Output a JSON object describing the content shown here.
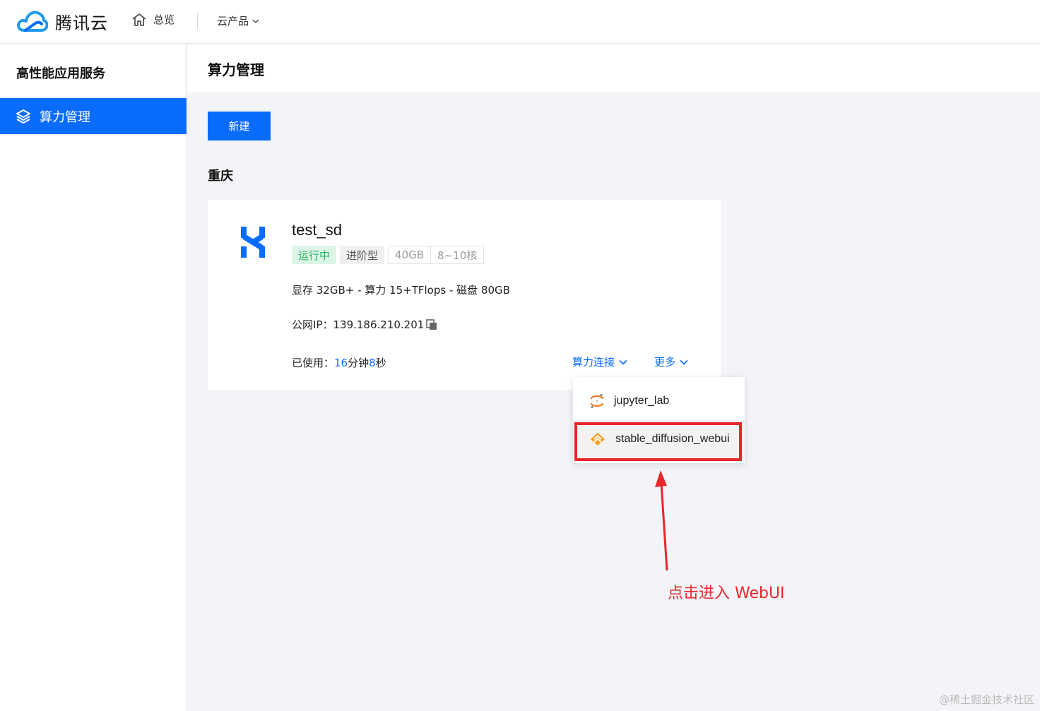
{
  "brand": {
    "name": "腾讯云"
  },
  "nav": {
    "home_label": "总览",
    "products_label": "云产品"
  },
  "sidebar": {
    "title": "高性能应用服务",
    "items": [
      {
        "label": "算力管理",
        "active": true
      }
    ]
  },
  "page": {
    "title": "算力管理"
  },
  "toolbar": {
    "new_label": "新建"
  },
  "region": {
    "title": "重庆"
  },
  "instance": {
    "name": "test_sd",
    "status": "运行中",
    "plan": "进阶型",
    "spec_gpu_mem": "40GB",
    "spec_cores": "8~10核",
    "specs": "显存 32GB+ - 算力 15+TFlops - 磁盘 80GB",
    "ip_label": "公网IP：",
    "ip": "139.186.210.201",
    "usage_label": "已使用：",
    "usage_minutes": "16",
    "usage_min_unit": "分钟",
    "usage_seconds": "8",
    "usage_sec_unit": "秒",
    "connect_label": "算力连接",
    "more_label": "更多"
  },
  "dropdown": {
    "items": [
      {
        "label": "jupyter_lab",
        "icon": "jupyter-icon"
      },
      {
        "label": "stable_diffusion_webui",
        "icon": "stable-diffusion-icon"
      }
    ]
  },
  "annotation": {
    "text": "点击进入 WebUI"
  },
  "watermark": {
    "text": "@稀土掘金技术社区"
  },
  "colors": {
    "primary": "#0a6cff",
    "running": "#22b363",
    "annotation": "#e8262b"
  }
}
